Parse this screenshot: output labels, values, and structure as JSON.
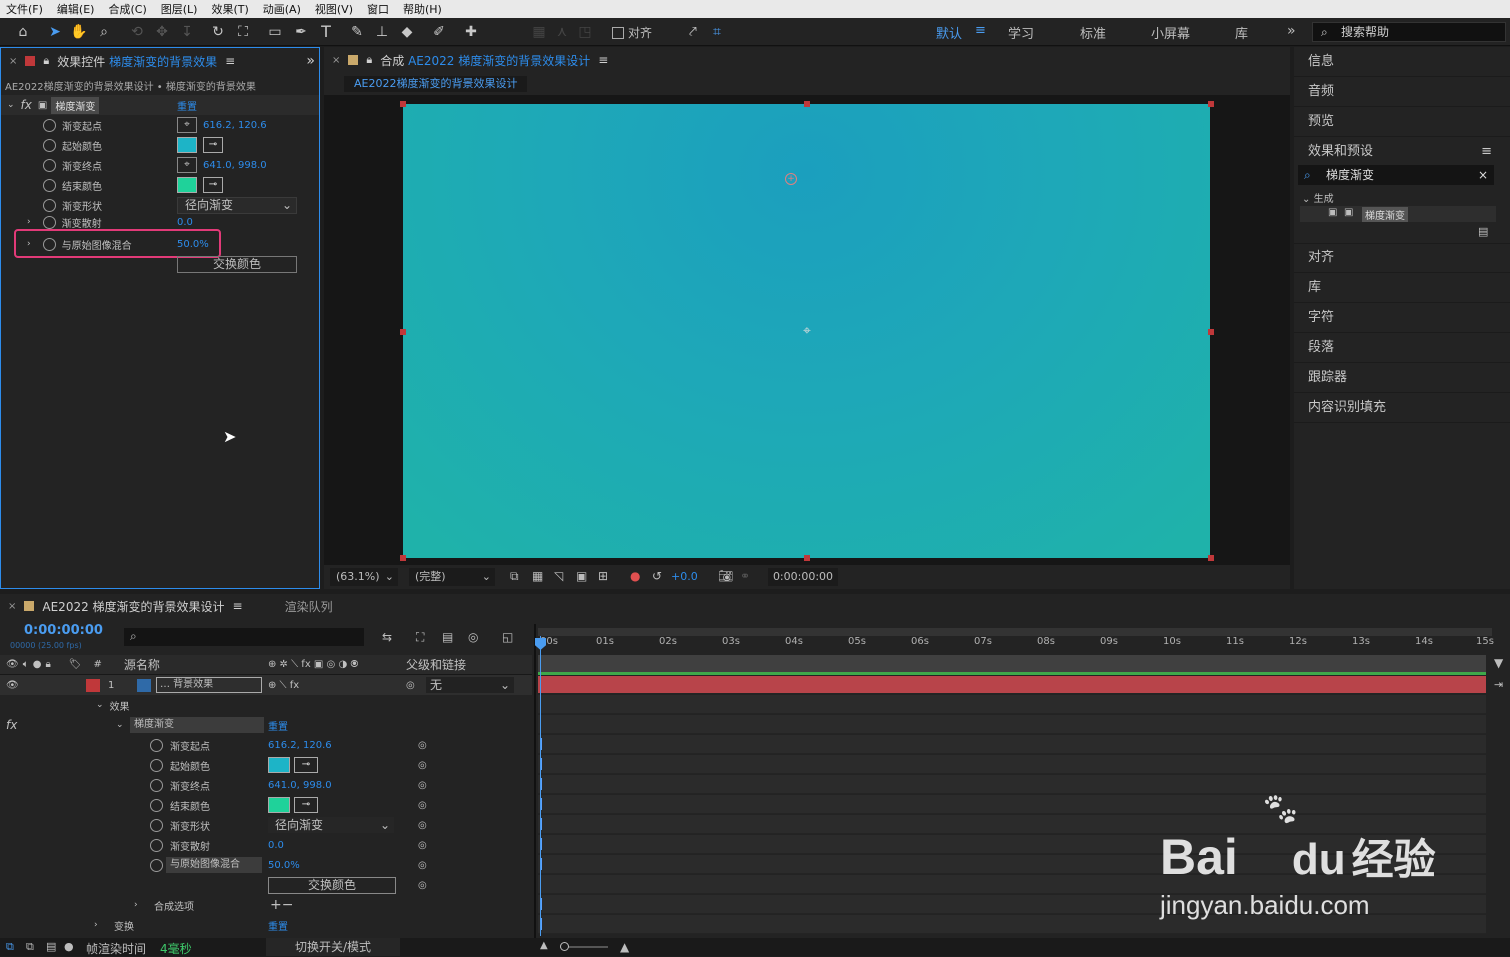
{
  "menu": [
    "文件(F)",
    "编辑(E)",
    "合成(C)",
    "图层(L)",
    "效果(T)",
    "动画(A)",
    "视图(V)",
    "窗口",
    "帮助(H)"
  ],
  "toolbar": {
    "align_label": "对齐",
    "workspaces": [
      "默认",
      "学习",
      "标准",
      "小屏幕",
      "库"
    ],
    "help_placeholder": "搜索帮助"
  },
  "effect_panel": {
    "tab_prefix": "效果控件",
    "tab_name": "梯度渐变的背景效果",
    "breadcrumb": "AE2022梯度渐变的背景效果设计 • 梯度渐变的背景效果",
    "effect_name": "梯度渐变",
    "reset": "重置",
    "props": [
      {
        "label": "渐变起点",
        "value": "616.2, 120.6"
      },
      {
        "label": "起始颜色",
        "color": "#1db4c7"
      },
      {
        "label": "渐变终点",
        "value": "641.0, 998.0"
      },
      {
        "label": "结束颜色",
        "color": "#1fd29a"
      },
      {
        "label": "渐变形状",
        "value": "径向渐变"
      },
      {
        "label": "渐变散射",
        "value": "0.0"
      },
      {
        "label": "与原始图像混合",
        "value": "50.0%"
      }
    ],
    "swap_button": "交换颜色"
  },
  "comp_panel": {
    "tab_prefix": "合成",
    "tab_name": "AE2022 梯度渐变的背景效果设计",
    "sub_tab": "AE2022梯度渐变的背景效果设计",
    "zoom": "(63.1%)",
    "quality": "(完整)",
    "exposure": "+0.0",
    "timecode": "0:00:00:00"
  },
  "right_panel": {
    "items": [
      "信息",
      "音频",
      "预览",
      "效果和预设"
    ],
    "search_value": "梯度渐变",
    "tree_group": "生成",
    "tree_item": "梯度渐变",
    "items2": [
      "对齐",
      "库",
      "字符",
      "段落",
      "跟踪器",
      "内容识别填充"
    ]
  },
  "timeline": {
    "tab_name": "AE2022 梯度渐变的背景效果设计",
    "render_queue": "渲染队列",
    "timecode": "0:00:00:00",
    "frames": "00000 (25.00 fps)",
    "col_source": "源名称",
    "col_parent": "父级和链接",
    "layer_num": "1",
    "layer_name": "… 背景效果",
    "parent_value": "无",
    "group_effects": "效果",
    "effect_name": "梯度渐变",
    "reset": "重置",
    "props": [
      {
        "label": "渐变起点",
        "value": "616.2, 120.6"
      },
      {
        "label": "起始颜色",
        "color": "#1db4c7"
      },
      {
        "label": "渐变终点",
        "value": "641.0, 998.0"
      },
      {
        "label": "结束颜色",
        "color": "#1fd29a"
      },
      {
        "label": "渐变形状",
        "value": "径向渐变"
      },
      {
        "label": "渐变散射",
        "value": "0.0"
      },
      {
        "label": "与原始图像混合",
        "value": "50.0%"
      }
    ],
    "swap_button": "交换颜色",
    "comp_options": "合成选项",
    "transform": "变换",
    "transform_reset": "重置",
    "ruler": [
      "00s",
      "01s",
      "02s",
      "03s",
      "04s",
      "05s",
      "06s",
      "07s",
      "08s",
      "09s",
      "10s",
      "11s",
      "12s",
      "13s",
      "14s",
      "15s"
    ],
    "footer_render_label": "帧渲染时间",
    "footer_render_value": "4毫秒",
    "footer_toggle": "切换开关/模式"
  },
  "watermark": {
    "brand": "Bai",
    "brand2": "du",
    "brand_cn": "经验",
    "url": "jingyan.baidu.com"
  },
  "colors": {
    "accent": "#2d8ceb",
    "highlight": "#e23a78",
    "layer_bar": "#b8444a"
  }
}
